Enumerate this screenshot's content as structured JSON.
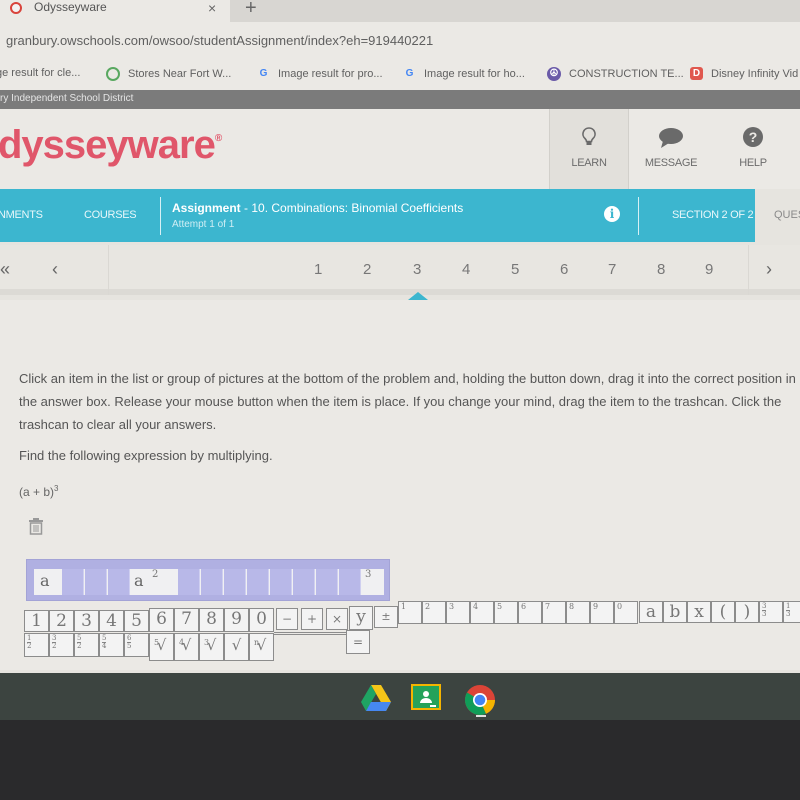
{
  "browser": {
    "tab_title": "Odysseyware",
    "tab_close": "×",
    "new_tab": "+",
    "url": "granbury.owschools.com/owsoo/studentAssignment/index?eh=919440221",
    "bookmarks": [
      {
        "label": "ge result for cle...",
        "icon": "google-icon"
      },
      {
        "label": "Stores Near Fort W...",
        "icon": "store-icon"
      },
      {
        "label": "Image result for pro...",
        "icon": "google-icon"
      },
      {
        "label": "Image result for ho...",
        "icon": "google-icon"
      },
      {
        "label": "CONSTRUCTION TE...",
        "icon": "peace-icon"
      },
      {
        "label": "Disney Infinity Vid",
        "icon": "disney-icon"
      }
    ]
  },
  "district": "ry Independent School District",
  "header": {
    "logo": "dysseyware",
    "logo_mark": "®",
    "buttons": [
      {
        "label": "LEARN",
        "icon": "lightbulb-icon"
      },
      {
        "label": "MESSAGE",
        "icon": "chat-bubble-icon"
      },
      {
        "label": "HELP",
        "icon": "question-icon"
      }
    ]
  },
  "nav": {
    "assignments": "NMENTS",
    "courses": "COURSES",
    "assignment_label": "Assignment",
    "assignment_name": " - 10. Combinations: Binomial Coefficients",
    "attempt": "Attempt 1 of 1",
    "info": "i",
    "section": "SECTION 2 OF 2",
    "questions": "QUES"
  },
  "pager": {
    "first": "«",
    "prev": "‹",
    "next": "›",
    "pages": [
      "1",
      "2",
      "3",
      "4",
      "5",
      "6",
      "7",
      "8",
      "9"
    ],
    "active_page": "3"
  },
  "content": {
    "instructions": "Click an item in the list or group of pictures at the bottom of the problem and, holding the button down, drag it into the correct position in the answer box. Release your mouse button when the item is place. If you change your mind, drag the item to the trashcan. Click the trashcan to clear all your answers.",
    "question": "Find the following expression by multiplying.",
    "expression_base": "(a + b)",
    "expression_exp": "3"
  },
  "answer_box": {
    "filled": [
      {
        "text": "a"
      },
      {
        "text": "a",
        "sup": "2"
      },
      {
        "sup": "3"
      }
    ]
  },
  "palette": {
    "row1_digits": [
      "1",
      "2",
      "3",
      "4",
      "5",
      "6",
      "7",
      "8",
      "9",
      "0"
    ],
    "row1_ops": [
      "−",
      "+",
      "×",
      "y",
      "±"
    ],
    "row1_small_digits": [
      "1",
      "2",
      "3",
      "4",
      "5",
      "6",
      "7",
      "8",
      "9",
      "0"
    ],
    "row1_vars": [
      "a",
      "b",
      "x",
      "(",
      ")"
    ],
    "row1_fracs": [
      {
        "num": "3",
        "den": "3"
      },
      {
        "num": "1",
        "den": "3"
      }
    ],
    "row2_fracs": [
      {
        "num": "1",
        "den": "2"
      },
      {
        "num": "3",
        "den": "2"
      },
      {
        "num": "5",
        "den": "2"
      },
      {
        "num": "5",
        "den": "4"
      },
      {
        "num": "6",
        "den": "5"
      }
    ],
    "row2_roots": [
      "5",
      "4",
      "3",
      "",
      "n"
    ],
    "equals": "="
  },
  "shelf": {
    "apps": [
      "google-drive",
      "google-classroom",
      "chrome"
    ]
  }
}
